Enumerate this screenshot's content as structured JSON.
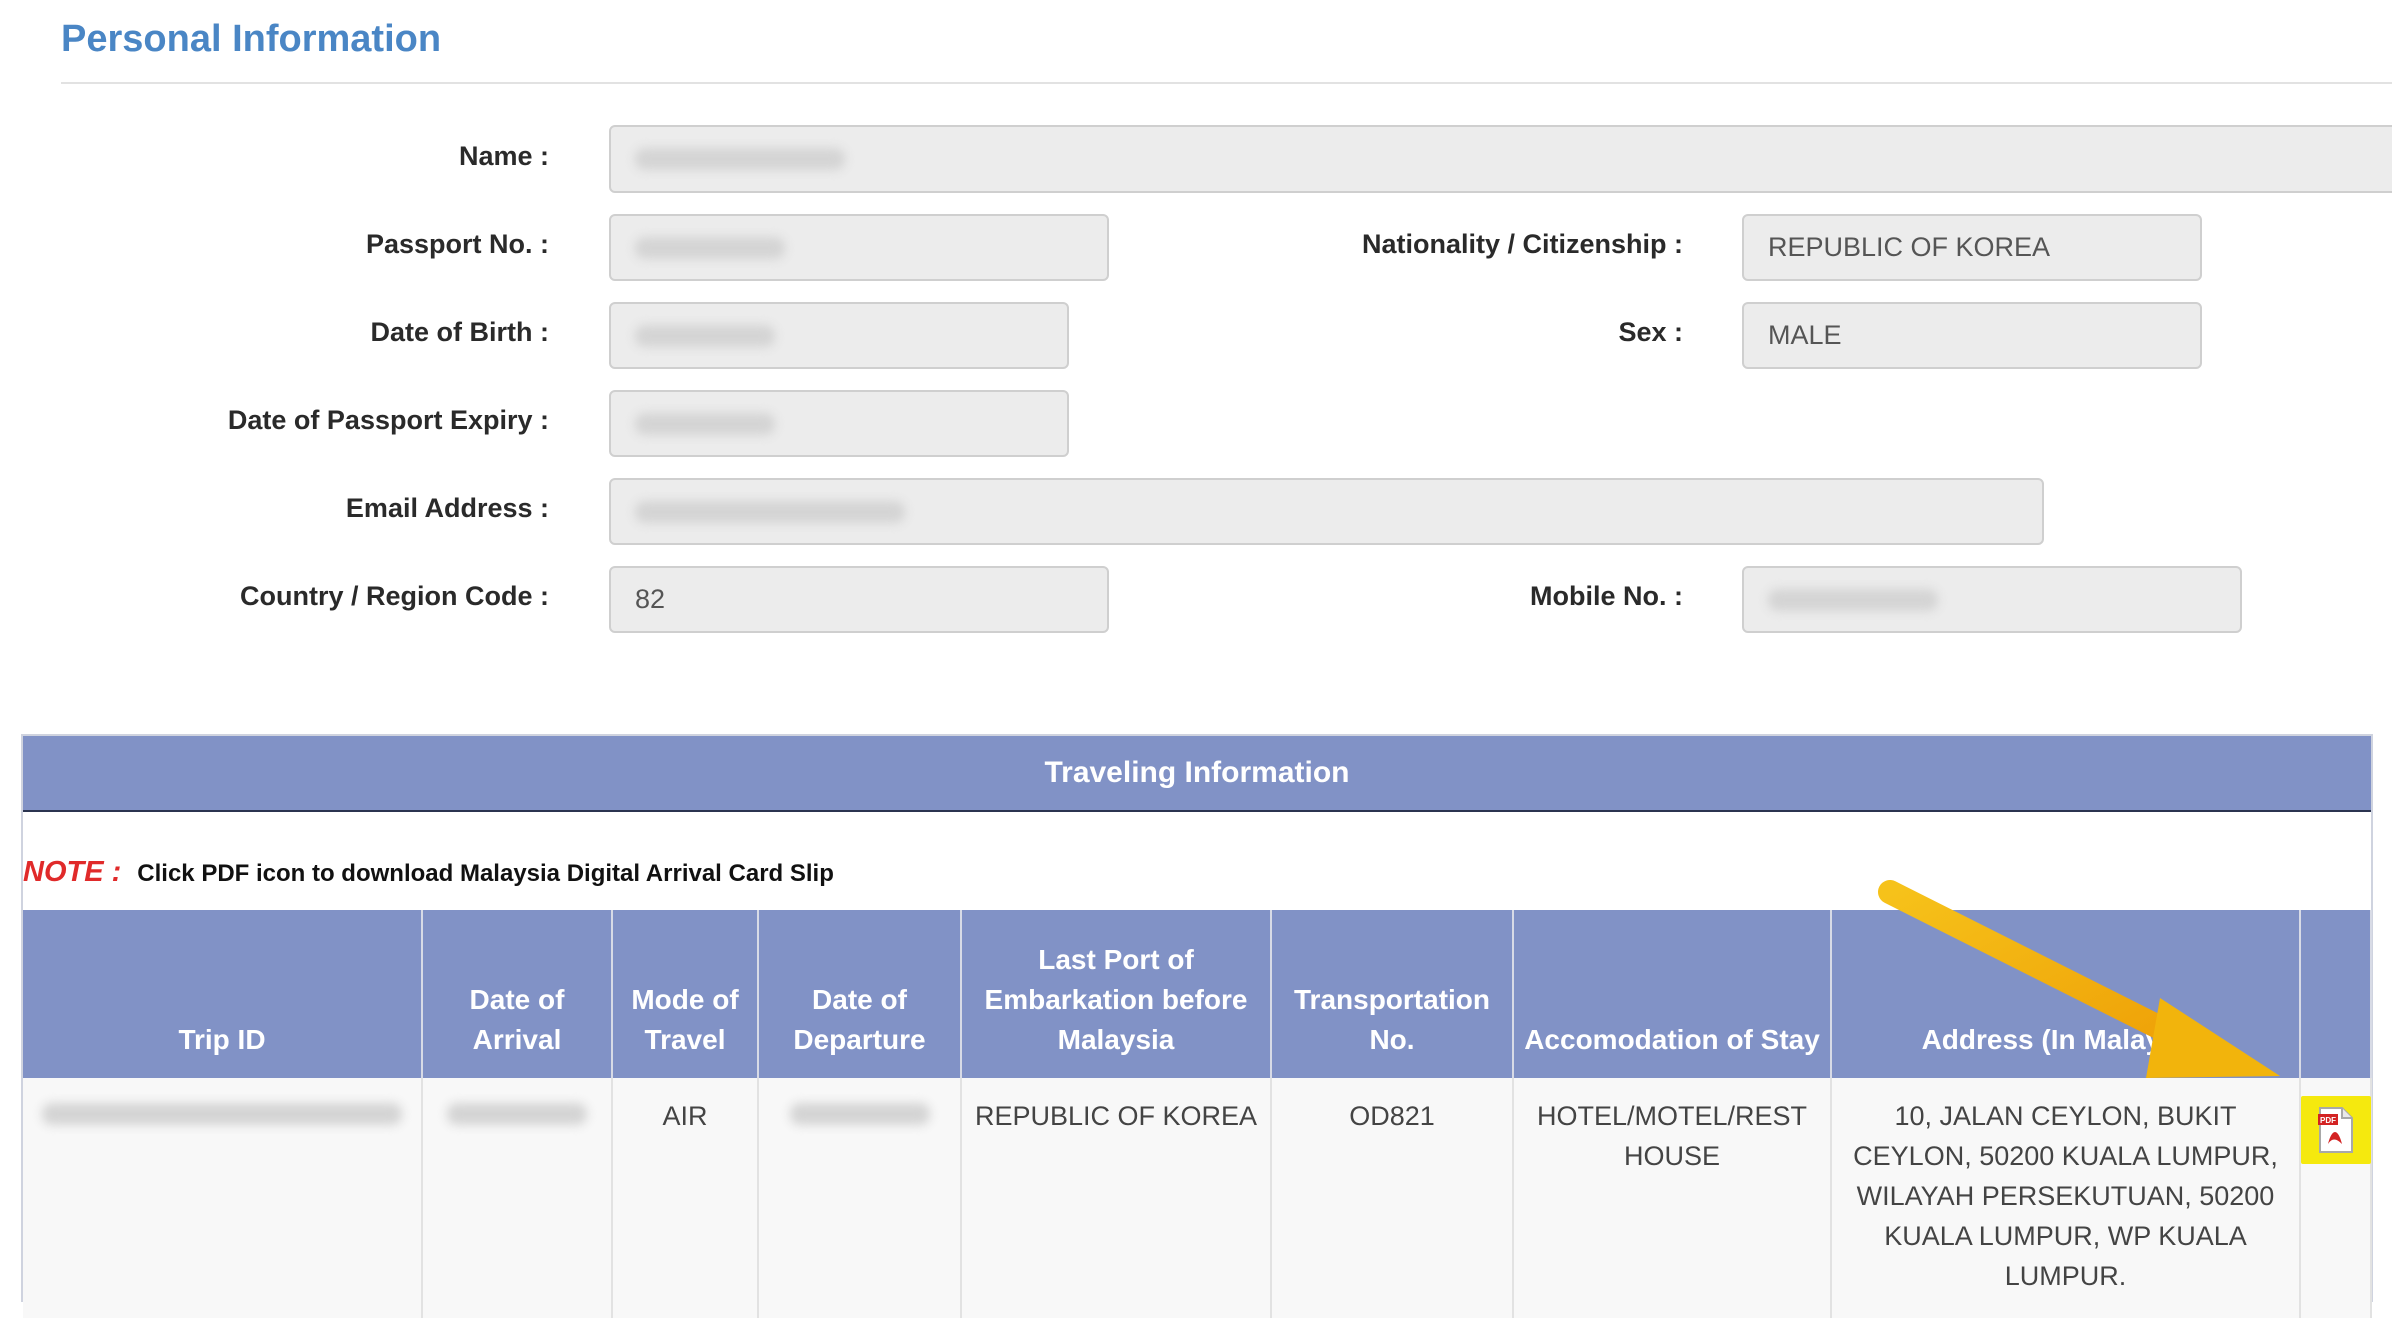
{
  "personal": {
    "title": "Personal Information",
    "name_label": "Name :",
    "passport_label": "Passport No. :",
    "nationality_label": "Nationality / Citizenship :",
    "nationality_value": "REPUBLIC OF KOREA",
    "dob_label": "Date of Birth :",
    "sex_label": "Sex :",
    "sex_value": "MALE",
    "expiry_label": "Date of Passport Expiry :",
    "email_label": "Email Address :",
    "region_label": "Country / Region Code :",
    "region_value": "82",
    "mobile_label": "Mobile No. :"
  },
  "travel": {
    "title": "Traveling Information",
    "note_tag": "NOTE :",
    "note_text": "Click PDF icon to download Malaysia Digital Arrival Card Slip",
    "columns": [
      "Trip ID",
      "Date of Arrival",
      "Mode of Travel",
      "Date of Departure",
      "Last Port of Embarkation before Malaysia",
      "Transportation No.",
      "Accomodation of Stay",
      "Address (In Malaysia)"
    ],
    "row": {
      "mode": "AIR",
      "last_port": "REPUBLIC OF KOREA",
      "transport_no": "OD821",
      "accommodation": "HOTEL/MOTEL/REST HOUSE",
      "address": "10, JALAN CEYLON, BUKIT CEYLON, 50200 KUALA LUMPUR, WILAYAH PERSEKUTUAN, 50200  KUALA LUMPUR, WP KUALA LUMPUR."
    },
    "pdf_icon_text": "PDF"
  },
  "colors": {
    "accent": "#4a86c5",
    "header": "#8192c6",
    "note": "#e02a2a",
    "pdf": "#f5e90e",
    "arrow": "#f2b40c"
  }
}
